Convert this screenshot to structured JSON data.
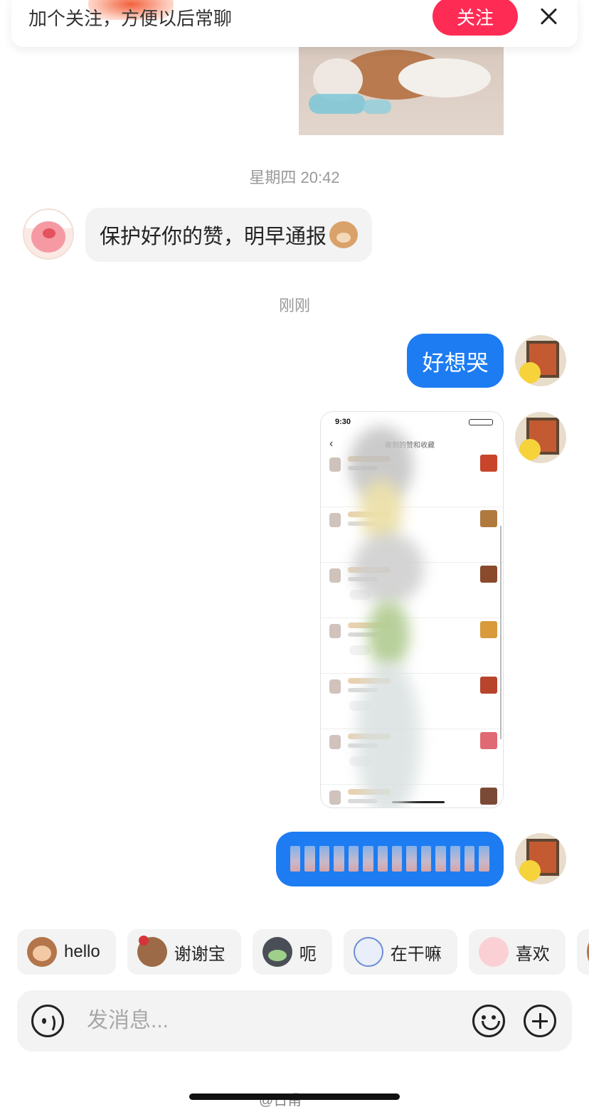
{
  "follow_banner": {
    "text": "加个关注，方便以后常聊",
    "follow_label": "关注"
  },
  "messages": {
    "time_1": "星期四 20:42",
    "incoming_1": "保护好你的赞，明早通报",
    "time_2": "刚刚",
    "outgoing_1": "好想哭"
  },
  "shared_screenshot": {
    "status_time": "9:30",
    "title": "收到的赞和收藏",
    "rows": 7
  },
  "quick_replies": [
    {
      "label": "hello",
      "icon": "monkey-sticker-icon"
    },
    {
      "label": "谢谢宝",
      "icon": "rose-monkey-sticker-icon"
    },
    {
      "label": "呃",
      "icon": "cat-sticker-icon"
    },
    {
      "label": "在干嘛",
      "icon": "magnifier-sticker-icon"
    },
    {
      "label": "喜欢",
      "icon": "pink-sticker-icon"
    }
  ],
  "composer": {
    "placeholder": "发消息..."
  },
  "watermark": "@日甫",
  "colors": {
    "accent": "#1d7cf2",
    "follow": "#fe2c55",
    "bubble_in": "#f3f3f3"
  }
}
